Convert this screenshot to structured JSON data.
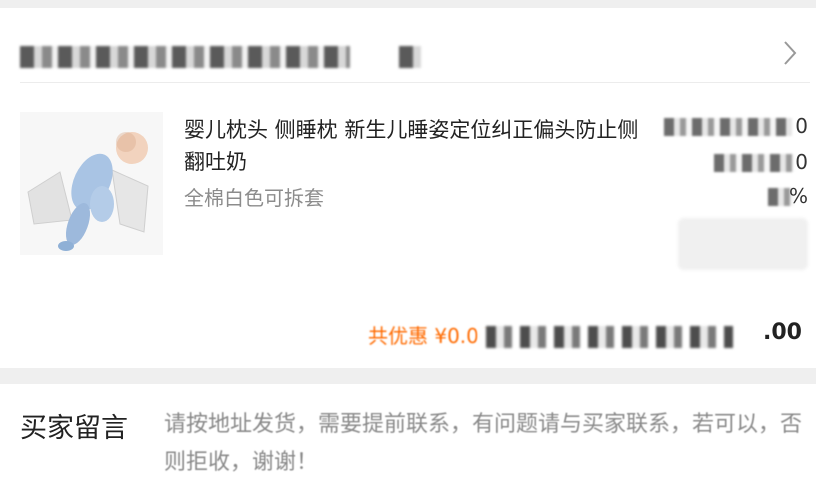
{
  "shop": {
    "name": "",
    "chevron": "chevron-right-icon"
  },
  "product": {
    "title": "婴儿枕头 侧睡枕 新生儿睡姿定位纠正偏头防止侧翻吐奶",
    "sku": "全棉白色可拆套",
    "image_icon": "baby-pillow-product-image",
    "price_tail": "0",
    "qty_tail": "0",
    "misc_tail": "%"
  },
  "summary": {
    "discount_label": "共优惠 ¥0.00",
    "total_tail": ".00"
  },
  "buyer_note": {
    "label": "买家留言",
    "text": "请按地址发货，需要提前联系，有问题请与买家联系，若可以，否则拒收，谢谢！"
  },
  "colors": {
    "accent": "#ff6a00",
    "muted_text": "#8c8c8c"
  }
}
